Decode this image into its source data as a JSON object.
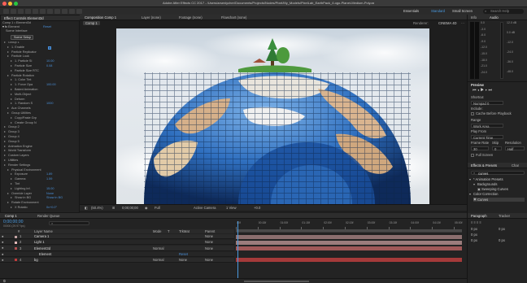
{
  "window": {
    "title": "Adobe After Effects CC 2017 - /Users/arseniycher/Documents/Projects/Nodes/Pixel/My_Models/PixelLab_EarthPack_/Logo-Planet-Medium-Poly.aep *",
    "workspace_items": [
      "Essentials",
      "Standard",
      "Small Screen"
    ],
    "search_placeholder": "Search Help"
  },
  "effect_controls": {
    "tab_label": "Effect Controls Element3d",
    "comp_path": "Comp 1 • Element3d",
    "effect_name": "Element",
    "reset_label": "Reset",
    "scene_interface": "Scene Interface",
    "scene_setup": "Scene Setup",
    "rows": [
      {
        "indent": 1,
        "label": "Group 1",
        "value": ""
      },
      {
        "indent": 2,
        "label": "1. Enable",
        "value": "",
        "check": true
      },
      {
        "indent": 2,
        "label": "Particle Replicator",
        "value": ""
      },
      {
        "indent": 2,
        "label": "Particle Look",
        "value": ""
      },
      {
        "indent": 3,
        "label": "1. Particle Si",
        "value": "10.00"
      },
      {
        "indent": 3,
        "label": "Particle Size",
        "value": "0.08"
      },
      {
        "indent": 3,
        "label": "Particle Size RTC",
        "value": ""
      },
      {
        "indent": 2,
        "label": "Particle Rotation",
        "value": ""
      },
      {
        "indent": 3,
        "label": "1. Color Tint",
        "value": ""
      },
      {
        "indent": 3,
        "label": "1. Force Opa",
        "value": "100.00"
      },
      {
        "indent": 3,
        "label": "Baked Animation",
        "value": ""
      },
      {
        "indent": 3,
        "label": "Multi-Object",
        "value": ""
      },
      {
        "indent": 3,
        "label": "Deform",
        "value": ""
      },
      {
        "indent": 3,
        "label": "1. Random S",
        "value": "1000"
      },
      {
        "indent": 2,
        "label": "Aux Channels",
        "value": ""
      },
      {
        "indent": 2,
        "label": "Group Utilities",
        "value": ""
      },
      {
        "indent": 3,
        "label": "Copy/Paste Grp",
        "value": ""
      },
      {
        "indent": 3,
        "label": "Create Group N",
        "value": ""
      },
      {
        "indent": 1,
        "label": "Group 2",
        "value": ""
      },
      {
        "indent": 1,
        "label": "Group 3",
        "value": ""
      },
      {
        "indent": 1,
        "label": "Group 4",
        "value": ""
      },
      {
        "indent": 1,
        "label": "Group 5",
        "value": ""
      },
      {
        "indent": 1,
        "label": "Animation Engine",
        "value": ""
      },
      {
        "indent": 1,
        "label": "World Transform",
        "value": ""
      },
      {
        "indent": 1,
        "label": "Custom Layers",
        "value": ""
      },
      {
        "indent": 1,
        "label": "Utilities",
        "value": ""
      },
      {
        "indent": 1,
        "label": "Render Settings",
        "value": ""
      },
      {
        "indent": 2,
        "label": "Physical Environment",
        "value": ""
      },
      {
        "indent": 3,
        "label": "Exposure",
        "value": "1.89"
      },
      {
        "indent": 3,
        "label": "Gamma",
        "value": "1.59"
      },
      {
        "indent": 3,
        "label": "Tint",
        "value": ""
      },
      {
        "indent": 3,
        "label": "Lighting Inf.",
        "value": "15.00"
      },
      {
        "indent": 2,
        "label": "Override Layer",
        "value": "None"
      },
      {
        "indent": 3,
        "label": "Show in BG",
        "value": "Show in BG"
      },
      {
        "indent": 2,
        "label": "Rotate Environment",
        "value": ""
      },
      {
        "indent": 3,
        "label": "X Rotatio",
        "value": "0x+0.0°"
      }
    ]
  },
  "composition": {
    "tabs": [
      "Composition Comp 1",
      "Layer (none)",
      "Footage (none)",
      "Flowchart (none)"
    ],
    "active_tab": "Comp 1",
    "renderer_label": "Renderer:",
    "renderer_value": "CINEMA 4D",
    "viewer_footer": {
      "zoom": "(50.4%)",
      "timecode": "0;00;00;00",
      "resolution": "Full",
      "camera": "Active Camera",
      "views": "1 View",
      "exposure": "+0.0"
    }
  },
  "info_audio": {
    "tabs": [
      "Info",
      "Audio"
    ],
    "levels_left": [
      "0.0",
      "-3.0",
      "-6.0",
      "-9.0",
      "-12.0",
      "-15.0",
      "-18.0",
      "-21.0",
      "-24.0"
    ],
    "levels_right": [
      "12.0 dB",
      "0.0 dB",
      "-12.0",
      "-24.0",
      "-36.0",
      "-48.0"
    ]
  },
  "preview": {
    "title": "Preview",
    "shortcut_label": "Shortcut",
    "shortcut_value": "Numpad 0",
    "include_label": "Include:",
    "cache_label": "Cache Before Playback",
    "range_label": "Range",
    "range_value": "Work Area",
    "play_from_label": "Play From",
    "play_from_value": "Current Time",
    "frame_rate_label": "Frame Rate",
    "skip_label": "Skip",
    "resolution_label": "Resolution",
    "frame_rate_value": "30",
    "skip_value": "0",
    "resolution_value": "Half",
    "fullscreen_label": "Full Screen"
  },
  "effects_presets": {
    "tabs": [
      "Effects & Presets",
      "Char"
    ],
    "search_value": "curves",
    "tree": [
      {
        "indent": 0,
        "label": "* Animation Presets"
      },
      {
        "indent": 1,
        "label": "Backgrounds"
      },
      {
        "indent": 2,
        "label": "Sweeping Curves"
      },
      {
        "indent": 0,
        "label": "Color Correction"
      },
      {
        "indent": 1,
        "label": "Curves",
        "selected": true
      }
    ]
  },
  "paragraph": {
    "tabs": [
      "Paragraph",
      "Tracker"
    ],
    "fields": [
      "0 px",
      "0 px",
      "0 px",
      "0 px",
      "0 px"
    ]
  },
  "timeline": {
    "tabs": [
      "Comp 1",
      "Render Queue"
    ],
    "timecode": "0;00;00;00",
    "fps": "00000 (29.97 fps)",
    "search_placeholder": "",
    "columns": [
      "#",
      "Layer Name",
      "Mode",
      "T",
      "TrkMat",
      "Parent"
    ],
    "ruler": [
      "00f",
      "00:15f",
      "01:00f",
      "01:15f",
      "02:00f",
      "02:15f",
      "03:00f",
      "03:15f",
      "04:00f",
      "04:15f",
      "05:00f"
    ],
    "layers": [
      {
        "num": "1",
        "name": "Camera 1",
        "mode": "",
        "trkmat": "",
        "parent": "None",
        "color": "#c4a3a3",
        "track": "#8b6f6f"
      },
      {
        "num": "2",
        "name": "Light 1",
        "mode": "",
        "trkmat": "",
        "parent": "None",
        "color": "#e0b8b8",
        "track": "#9c7c7c"
      },
      {
        "num": "3",
        "name": "Element3d",
        "mode": "Normal",
        "trkmat": "",
        "parent": "None",
        "color": "#b05050",
        "track": "#a05858"
      },
      {
        "num": "",
        "name": "Element",
        "mode": "",
        "trkmat": "Reset",
        "parent": "",
        "color": "",
        "track": ""
      },
      {
        "num": "4",
        "name": "bg",
        "mode": "Normal",
        "trkmat": "None",
        "parent": "None",
        "color": "#c23c3c",
        "track": "#a53a3a"
      }
    ]
  },
  "colors": {
    "accent": "#2d8cf0",
    "playhead": "#4a9ae0",
    "ocean": "#2f6fbf"
  }
}
